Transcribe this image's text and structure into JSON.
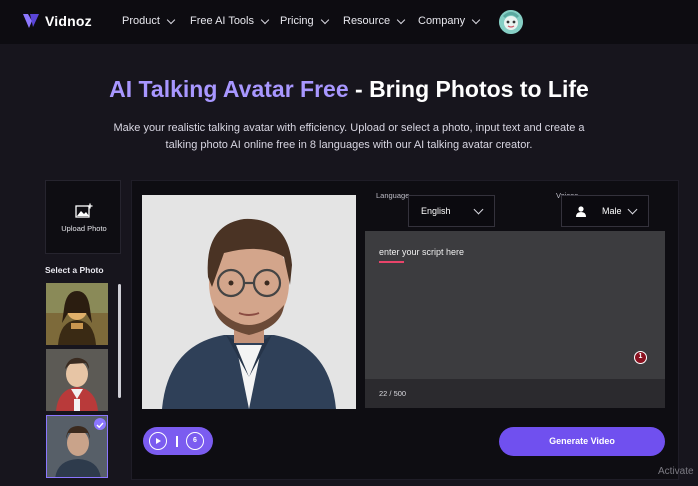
{
  "nav": {
    "brand": "Vidnoz",
    "items": [
      {
        "label": "Product"
      },
      {
        "label": "Free AI Tools"
      },
      {
        "label": "Pricing"
      },
      {
        "label": "Resource"
      },
      {
        "label": "Company"
      }
    ]
  },
  "hero": {
    "title_highlight": "AI Talking Avatar Free",
    "title_rest": " - Bring Photos to Life",
    "subtitle": "Make your realistic talking avatar with efficiency. Upload or select a photo, input text and create a talking photo AI online free in 8 languages with our AI talking avatar creator."
  },
  "left_panel": {
    "upload_label": "Upload Photo",
    "select_label": "Select a Photo"
  },
  "editor": {
    "language_label": "Language",
    "language_value": "English",
    "voices_label": "Voices",
    "voice_value": "Male",
    "script_placeholder": "enter your script here",
    "issue_count": "1",
    "char_counter": "22 / 500",
    "generate_label": "Generate Video"
  },
  "colors": {
    "accent": "#7050ef",
    "title_highlight": "#a897ff",
    "background": "#17151d"
  },
  "watermark": "Activate"
}
